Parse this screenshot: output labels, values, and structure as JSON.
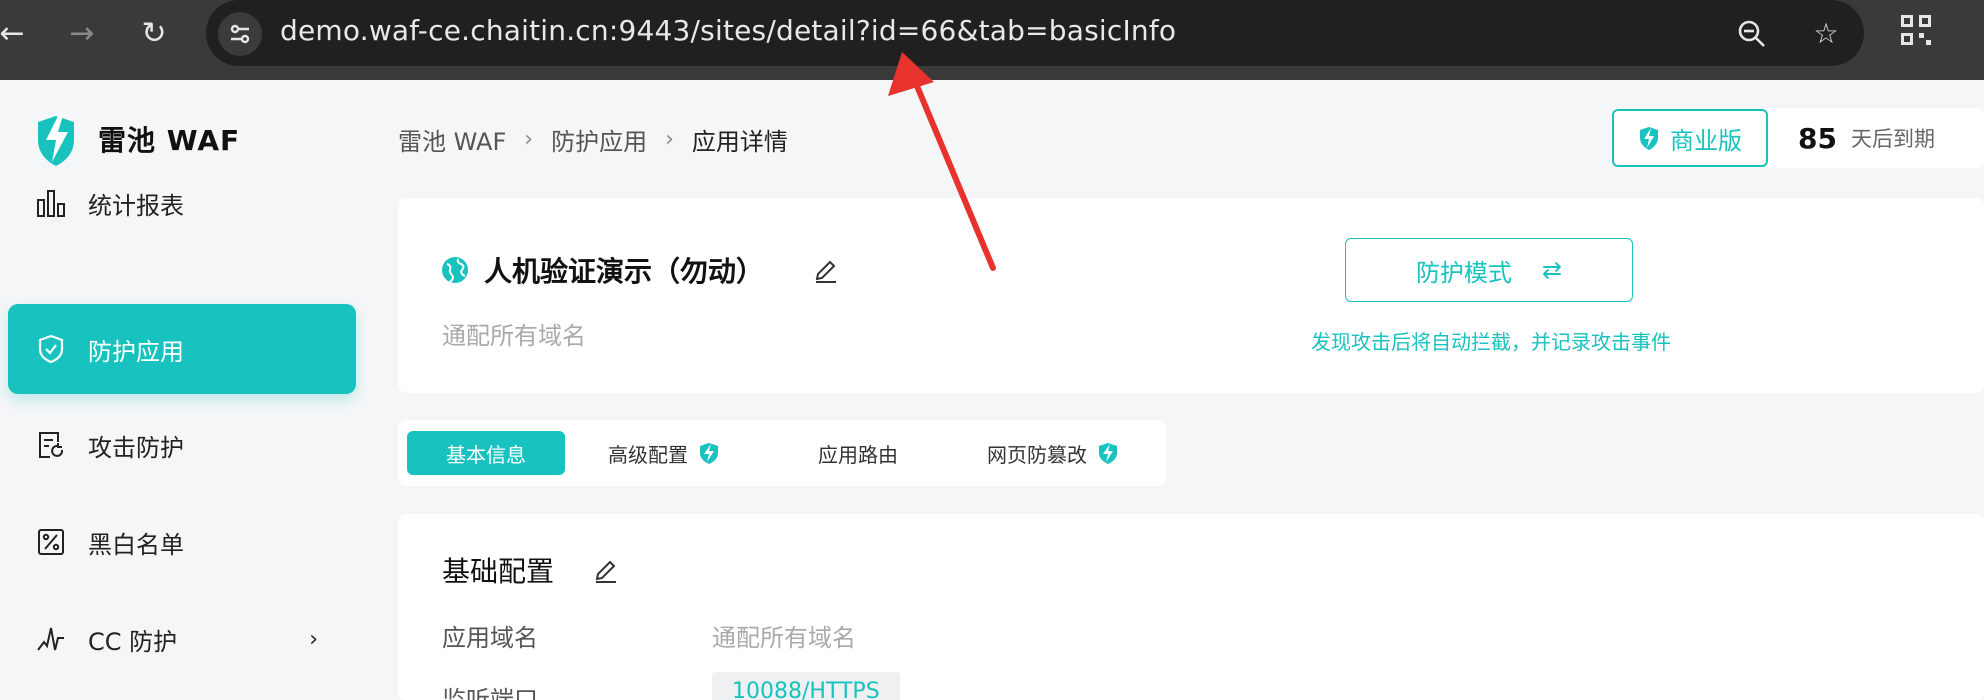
{
  "browser": {
    "url": "demo.waf-ce.chaitin.cn:9443/sites/detail?id=66&tab=basicInfo"
  },
  "brand": {
    "name": "雷池 WAF",
    "color": "#18c2bf"
  },
  "sidebar": {
    "items": [
      {
        "label": "统计报表",
        "icon": "bar-chart-icon"
      },
      {
        "label": "防护应用",
        "icon": "shield-check-icon",
        "active": true
      },
      {
        "label": "攻击防护",
        "icon": "document-refresh-icon"
      },
      {
        "label": "黑白名单",
        "icon": "percent-box-icon"
      },
      {
        "label": "CC 防护",
        "icon": "pulse-icon"
      }
    ]
  },
  "breadcrumb": [
    "雷池 WAF",
    "防护应用",
    "应用详情"
  ],
  "license": {
    "edition": "商业版",
    "days": "85",
    "days_label": "天后到期"
  },
  "app": {
    "name": "人机验证演示（勿动）",
    "domain": "通配所有域名",
    "mode_label": "防护模式",
    "mode_desc": "发现攻击后将自动拦截，并记录攻击事件"
  },
  "tabs": [
    {
      "label": "基本信息",
      "active": true
    },
    {
      "label": "高级配置",
      "badge": true
    },
    {
      "label": "应用路由"
    },
    {
      "label": "网页防篡改",
      "badge": true
    }
  ],
  "config": {
    "title": "基础配置",
    "domain_label": "应用域名",
    "domain_value": "通配所有域名",
    "port_label": "监听端口",
    "port_value": "10088/HTTPS"
  }
}
